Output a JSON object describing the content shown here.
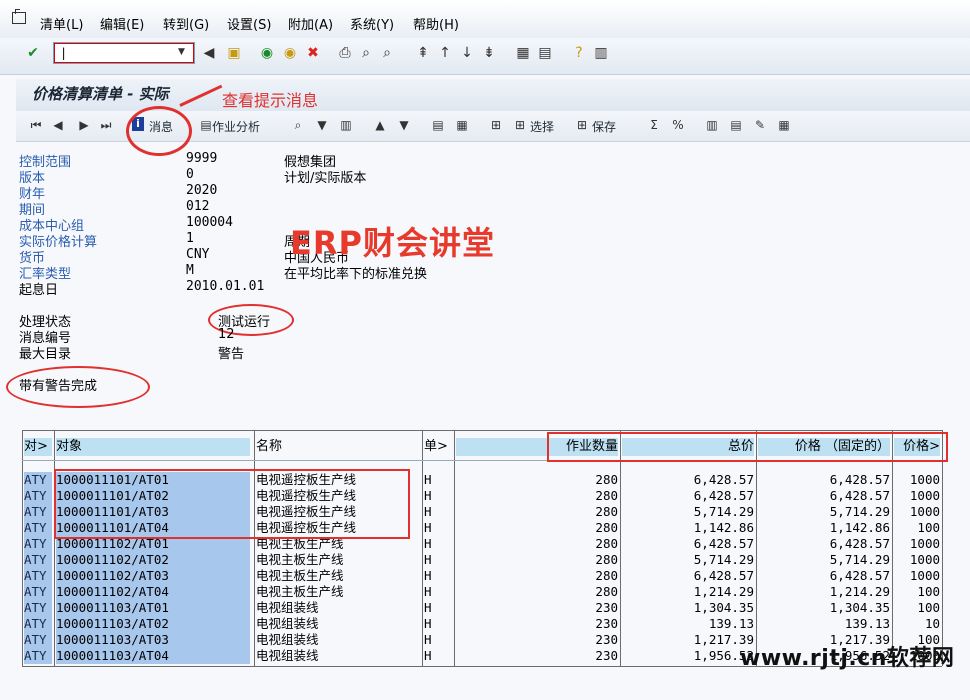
{
  "menu": [
    "清单(L)",
    "编辑(E)",
    "转到(G)",
    "设置(S)",
    "附加(A)",
    "系统(Y)",
    "帮助(H)"
  ],
  "command_field": {
    "value": "|"
  },
  "page_title": "价格清算清单 - 实际",
  "annotation_top": "查看提示消息",
  "watermark": "ERP财会讲堂",
  "site_watermark": "www.rjtj.cn软荐网",
  "toolbar2": {
    "message_label": "消息",
    "activity_analysis_label": "作业分析",
    "select_label": "选择",
    "save_label": "保存"
  },
  "header": [
    {
      "label": "控制范围",
      "value": "9999",
      "desc": "假想集团"
    },
    {
      "label": "版本",
      "value": "0",
      "desc": "计划/实际版本"
    },
    {
      "label": "财年",
      "value": "2020",
      "desc": ""
    },
    {
      "label": "期间",
      "value": "012",
      "desc": ""
    },
    {
      "label": "成本中心组",
      "value": "100004",
      "desc": ""
    },
    {
      "label": "实际价格计算",
      "value": "1",
      "desc": "周期"
    },
    {
      "label": "货币",
      "value": "CNY",
      "desc": "中国人民币"
    },
    {
      "label": "汇率类型",
      "value": "M",
      "desc": "在平均比率下的标准兑换"
    },
    {
      "label": "起息日",
      "value": "2010.01.01",
      "desc": ""
    }
  ],
  "status": [
    {
      "label": "处理状态",
      "value": "测试运行"
    },
    {
      "label": "消息编号",
      "value": "12"
    },
    {
      "label": "最大目录",
      "value": "警告"
    }
  ],
  "completion_text": "带有警告完成",
  "table": {
    "headers": [
      "对>",
      "对象",
      "名称",
      "单>",
      "作业数量",
      "总价",
      "价格 （固定的）",
      "价格>"
    ],
    "rows": [
      [
        "ATY",
        "1000011101/AT01",
        "电视遥控板生产线",
        "H",
        "280",
        "6,428.57",
        "6,428.57",
        "1000"
      ],
      [
        "ATY",
        "1000011101/AT02",
        "电视遥控板生产线",
        "H",
        "280",
        "6,428.57",
        "6,428.57",
        "1000"
      ],
      [
        "ATY",
        "1000011101/AT03",
        "电视遥控板生产线",
        "H",
        "280",
        "5,714.29",
        "5,714.29",
        "1000"
      ],
      [
        "ATY",
        "1000011101/AT04",
        "电视遥控板生产线",
        "H",
        "280",
        "1,142.86",
        "1,142.86",
        "100"
      ],
      [
        "ATY",
        "1000011102/AT01",
        "电视主板生产线",
        "H",
        "280",
        "6,428.57",
        "6,428.57",
        "1000"
      ],
      [
        "ATY",
        "1000011102/AT02",
        "电视主板生产线",
        "H",
        "280",
        "5,714.29",
        "5,714.29",
        "1000"
      ],
      [
        "ATY",
        "1000011102/AT03",
        "电视主板生产线",
        "H",
        "280",
        "6,428.57",
        "6,428.57",
        "1000"
      ],
      [
        "ATY",
        "1000011102/AT04",
        "电视主板生产线",
        "H",
        "280",
        "1,214.29",
        "1,214.29",
        "100"
      ],
      [
        "ATY",
        "1000011103/AT01",
        "电视组装线",
        "H",
        "230",
        "1,304.35",
        "1,304.35",
        "100"
      ],
      [
        "ATY",
        "1000011103/AT02",
        "电视组装线",
        "H",
        "230",
        "139.13",
        "139.13",
        "10"
      ],
      [
        "ATY",
        "1000011103/AT03",
        "电视组装线",
        "H",
        "230",
        "1,217.39",
        "1,217.39",
        "100"
      ],
      [
        "ATY",
        "1000011103/AT04",
        "电视组装线",
        "H",
        "230",
        "1,956.52",
        "1,956.52",
        "1000"
      ]
    ]
  }
}
